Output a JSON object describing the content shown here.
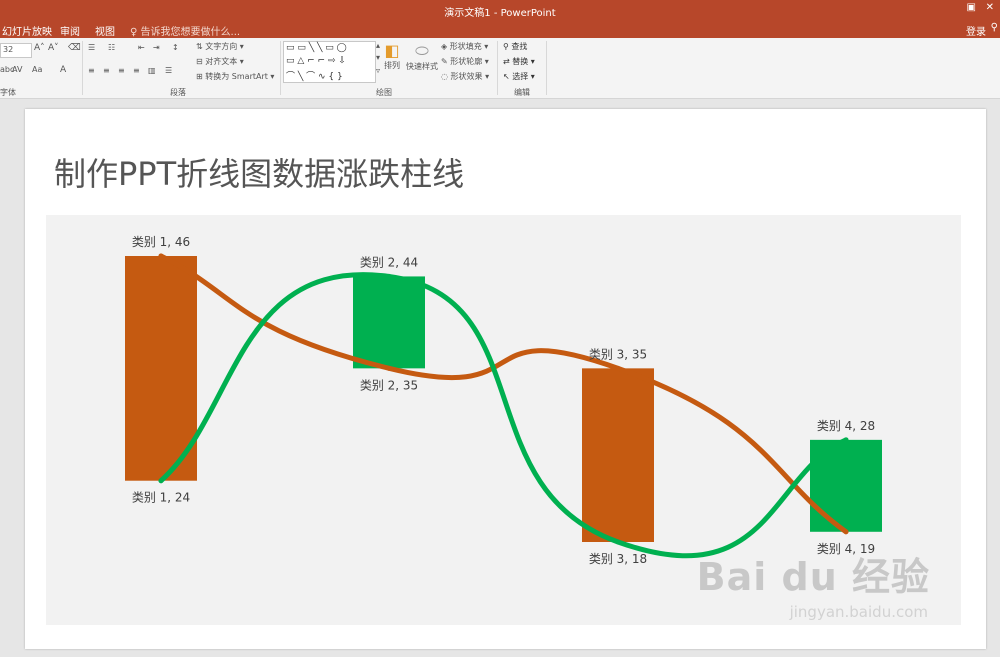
{
  "app": {
    "window_title": "演示文稿1 - PowerPoint",
    "tabs": [
      "幻灯片放映",
      "审阅",
      "视图"
    ],
    "tell_me": "告诉我您想要做什么...",
    "login": "登录"
  },
  "ribbon": {
    "font_size": "32",
    "groups": {
      "font": "字体",
      "paragraph": "段落",
      "drawing": "绘图",
      "editing": "编辑"
    },
    "paragraph": {
      "text_direction": "文字方向",
      "align_text": "对齐文本",
      "smartart": "转换为 SmartArt"
    },
    "drawing": {
      "arrange": "排列",
      "quick_styles": "快速样式",
      "fill": "形状填充",
      "outline": "形状轮廓",
      "effects": "形状效果"
    },
    "editing": {
      "find": "查找",
      "replace": "替换",
      "select": "选择"
    }
  },
  "slide": {
    "title": "制作PPT折线图数据涨跌柱线"
  },
  "chart_data": {
    "type": "line",
    "categories": [
      "类别 1",
      "类别 2",
      "类别 3",
      "类别 4"
    ],
    "series": [
      {
        "values": [
          46,
          35,
          35,
          19
        ],
        "color": "#c55a11"
      },
      {
        "values": [
          24,
          44,
          18,
          28
        ],
        "color": "#00b050"
      }
    ],
    "up_down_bars": true,
    "up_bar_color": "#00b050",
    "down_bar_color": "#c55a11",
    "data_labels": [
      {
        "text": "类别 1, 46"
      },
      {
        "text": "类别 1, 24"
      },
      {
        "text": "类别 2, 44"
      },
      {
        "text": "类别 2, 35"
      },
      {
        "text": "类别 3, 35"
      },
      {
        "text": "类别 3, 18"
      },
      {
        "text": "类别 4, 28"
      },
      {
        "text": "类别 4, 19"
      }
    ],
    "smooth": true,
    "grid": false,
    "legend": "none"
  },
  "watermark": {
    "brand": "Bai du 经验",
    "url": "jingyan.baidu.com"
  }
}
